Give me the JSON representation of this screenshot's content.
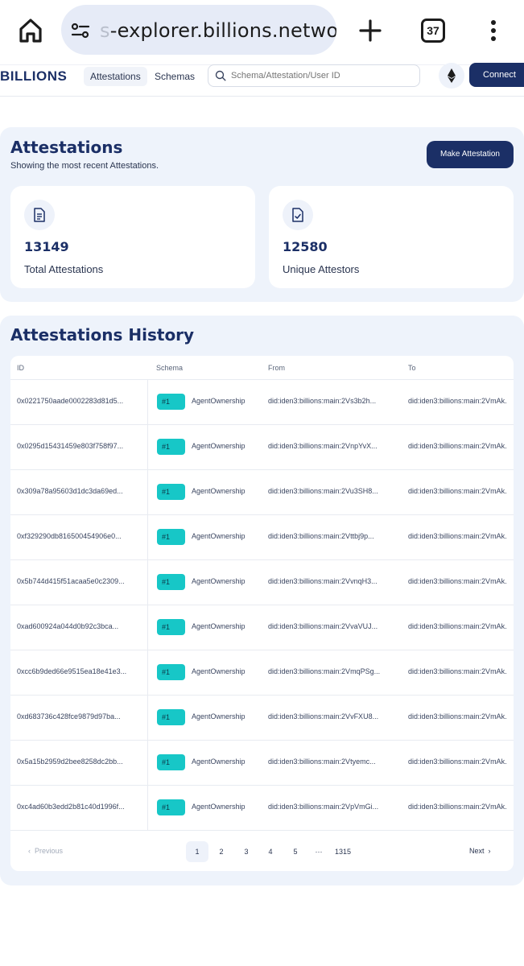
{
  "browser": {
    "url_faded": "s",
    "url": "-explorer.billions.network",
    "tab_count": "37"
  },
  "header": {
    "logo": "BILLIONS",
    "nav": [
      "Attestations",
      "Schemas"
    ],
    "search_placeholder": "Schema/Attestation/User ID",
    "connect_label": "Connect"
  },
  "summary": {
    "title": "Attestations",
    "subtitle": "Showing the most recent Attestations.",
    "make_button": "Make Attestation",
    "stats": [
      {
        "value": "13149",
        "label": "Total Attestations",
        "icon": "document-icon"
      },
      {
        "value": "12580",
        "label": "Unique Attestors",
        "icon": "file-check-icon"
      }
    ]
  },
  "history": {
    "title": "Attestations History",
    "columns": [
      "ID",
      "Schema",
      "From",
      "To"
    ],
    "rows": [
      {
        "id": "0x0221750aade0002283d81d5...",
        "badge": "#1",
        "schema": "AgentOwnership",
        "from": "did:iden3:billions:main:2Vs3b2h...",
        "to": "did:iden3:billions:main:2VmAk."
      },
      {
        "id": "0x0295d15431459e803f758f97...",
        "badge": "#1",
        "schema": "AgentOwnership",
        "from": "did:iden3:billions:main:2VnpYvX...",
        "to": "did:iden3:billions:main:2VmAk."
      },
      {
        "id": "0x309a78a95603d1dc3da69ed...",
        "badge": "#1",
        "schema": "AgentOwnership",
        "from": "did:iden3:billions:main:2Vu3SH8...",
        "to": "did:iden3:billions:main:2VmAk."
      },
      {
        "id": "0xf329290db816500454906e0...",
        "badge": "#1",
        "schema": "AgentOwnership",
        "from": "did:iden3:billions:main:2Vttbj9p...",
        "to": "did:iden3:billions:main:2VmAk."
      },
      {
        "id": "0x5b744d415f51acaa5e0c2309...",
        "badge": "#1",
        "schema": "AgentOwnership",
        "from": "did:iden3:billions:main:2VvnqH3...",
        "to": "did:iden3:billions:main:2VmAk."
      },
      {
        "id": "0xad600924a044d0b92c3bca...",
        "badge": "#1",
        "schema": "AgentOwnership",
        "from": "did:iden3:billions:main:2VvaVUJ...",
        "to": "did:iden3:billions:main:2VmAk."
      },
      {
        "id": "0xcc6b9ded66e9515ea18e41e3...",
        "badge": "#1",
        "schema": "AgentOwnership",
        "from": "did:iden3:billions:main:2VmqPSg...",
        "to": "did:iden3:billions:main:2VmAk."
      },
      {
        "id": "0xd683736c428fce9879d97ba...",
        "badge": "#1",
        "schema": "AgentOwnership",
        "from": "did:iden3:billions:main:2VvFXU8...",
        "to": "did:iden3:billions:main:2VmAk."
      },
      {
        "id": "0x5a15b2959d2bee8258dc2bb...",
        "badge": "#1",
        "schema": "AgentOwnership",
        "from": "did:iden3:billions:main:2Vtyemc...",
        "to": "did:iden3:billions:main:2VmAk."
      },
      {
        "id": "0xc4ad60b3edd2b81c40d1996f...",
        "badge": "#1",
        "schema": "AgentOwnership",
        "from": "did:iden3:billions:main:2VpVmGi...",
        "to": "did:iden3:billions:main:2VmAk."
      }
    ],
    "pagination": {
      "previous": "Previous",
      "pages": [
        "1",
        "2",
        "3",
        "4",
        "5",
        "···",
        "1315"
      ],
      "current": "1",
      "next": "Next"
    }
  },
  "colors": {
    "brand": "#1b2f66",
    "badge": "#17c7c7",
    "panel": "#eef3fb"
  }
}
